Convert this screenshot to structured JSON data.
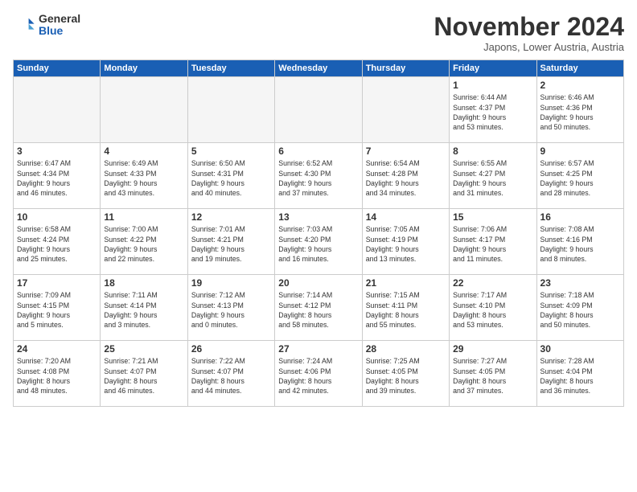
{
  "logo": {
    "general": "General",
    "blue": "Blue"
  },
  "header": {
    "month": "November 2024",
    "location": "Japons, Lower Austria, Austria"
  },
  "weekdays": [
    "Sunday",
    "Monday",
    "Tuesday",
    "Wednesday",
    "Thursday",
    "Friday",
    "Saturday"
  ],
  "weeks": [
    [
      {
        "day": "",
        "detail": ""
      },
      {
        "day": "",
        "detail": ""
      },
      {
        "day": "",
        "detail": ""
      },
      {
        "day": "",
        "detail": ""
      },
      {
        "day": "",
        "detail": ""
      },
      {
        "day": "1",
        "detail": "Sunrise: 6:44 AM\nSunset: 4:37 PM\nDaylight: 9 hours\nand 53 minutes."
      },
      {
        "day": "2",
        "detail": "Sunrise: 6:46 AM\nSunset: 4:36 PM\nDaylight: 9 hours\nand 50 minutes."
      }
    ],
    [
      {
        "day": "3",
        "detail": "Sunrise: 6:47 AM\nSunset: 4:34 PM\nDaylight: 9 hours\nand 46 minutes."
      },
      {
        "day": "4",
        "detail": "Sunrise: 6:49 AM\nSunset: 4:33 PM\nDaylight: 9 hours\nand 43 minutes."
      },
      {
        "day": "5",
        "detail": "Sunrise: 6:50 AM\nSunset: 4:31 PM\nDaylight: 9 hours\nand 40 minutes."
      },
      {
        "day": "6",
        "detail": "Sunrise: 6:52 AM\nSunset: 4:30 PM\nDaylight: 9 hours\nand 37 minutes."
      },
      {
        "day": "7",
        "detail": "Sunrise: 6:54 AM\nSunset: 4:28 PM\nDaylight: 9 hours\nand 34 minutes."
      },
      {
        "day": "8",
        "detail": "Sunrise: 6:55 AM\nSunset: 4:27 PM\nDaylight: 9 hours\nand 31 minutes."
      },
      {
        "day": "9",
        "detail": "Sunrise: 6:57 AM\nSunset: 4:25 PM\nDaylight: 9 hours\nand 28 minutes."
      }
    ],
    [
      {
        "day": "10",
        "detail": "Sunrise: 6:58 AM\nSunset: 4:24 PM\nDaylight: 9 hours\nand 25 minutes."
      },
      {
        "day": "11",
        "detail": "Sunrise: 7:00 AM\nSunset: 4:22 PM\nDaylight: 9 hours\nand 22 minutes."
      },
      {
        "day": "12",
        "detail": "Sunrise: 7:01 AM\nSunset: 4:21 PM\nDaylight: 9 hours\nand 19 minutes."
      },
      {
        "day": "13",
        "detail": "Sunrise: 7:03 AM\nSunset: 4:20 PM\nDaylight: 9 hours\nand 16 minutes."
      },
      {
        "day": "14",
        "detail": "Sunrise: 7:05 AM\nSunset: 4:19 PM\nDaylight: 9 hours\nand 13 minutes."
      },
      {
        "day": "15",
        "detail": "Sunrise: 7:06 AM\nSunset: 4:17 PM\nDaylight: 9 hours\nand 11 minutes."
      },
      {
        "day": "16",
        "detail": "Sunrise: 7:08 AM\nSunset: 4:16 PM\nDaylight: 9 hours\nand 8 minutes."
      }
    ],
    [
      {
        "day": "17",
        "detail": "Sunrise: 7:09 AM\nSunset: 4:15 PM\nDaylight: 9 hours\nand 5 minutes."
      },
      {
        "day": "18",
        "detail": "Sunrise: 7:11 AM\nSunset: 4:14 PM\nDaylight: 9 hours\nand 3 minutes."
      },
      {
        "day": "19",
        "detail": "Sunrise: 7:12 AM\nSunset: 4:13 PM\nDaylight: 9 hours\nand 0 minutes."
      },
      {
        "day": "20",
        "detail": "Sunrise: 7:14 AM\nSunset: 4:12 PM\nDaylight: 8 hours\nand 58 minutes."
      },
      {
        "day": "21",
        "detail": "Sunrise: 7:15 AM\nSunset: 4:11 PM\nDaylight: 8 hours\nand 55 minutes."
      },
      {
        "day": "22",
        "detail": "Sunrise: 7:17 AM\nSunset: 4:10 PM\nDaylight: 8 hours\nand 53 minutes."
      },
      {
        "day": "23",
        "detail": "Sunrise: 7:18 AM\nSunset: 4:09 PM\nDaylight: 8 hours\nand 50 minutes."
      }
    ],
    [
      {
        "day": "24",
        "detail": "Sunrise: 7:20 AM\nSunset: 4:08 PM\nDaylight: 8 hours\nand 48 minutes."
      },
      {
        "day": "25",
        "detail": "Sunrise: 7:21 AM\nSunset: 4:07 PM\nDaylight: 8 hours\nand 46 minutes."
      },
      {
        "day": "26",
        "detail": "Sunrise: 7:22 AM\nSunset: 4:07 PM\nDaylight: 8 hours\nand 44 minutes."
      },
      {
        "day": "27",
        "detail": "Sunrise: 7:24 AM\nSunset: 4:06 PM\nDaylight: 8 hours\nand 42 minutes."
      },
      {
        "day": "28",
        "detail": "Sunrise: 7:25 AM\nSunset: 4:05 PM\nDaylight: 8 hours\nand 39 minutes."
      },
      {
        "day": "29",
        "detail": "Sunrise: 7:27 AM\nSunset: 4:05 PM\nDaylight: 8 hours\nand 37 minutes."
      },
      {
        "day": "30",
        "detail": "Sunrise: 7:28 AM\nSunset: 4:04 PM\nDaylight: 8 hours\nand 36 minutes."
      }
    ]
  ]
}
